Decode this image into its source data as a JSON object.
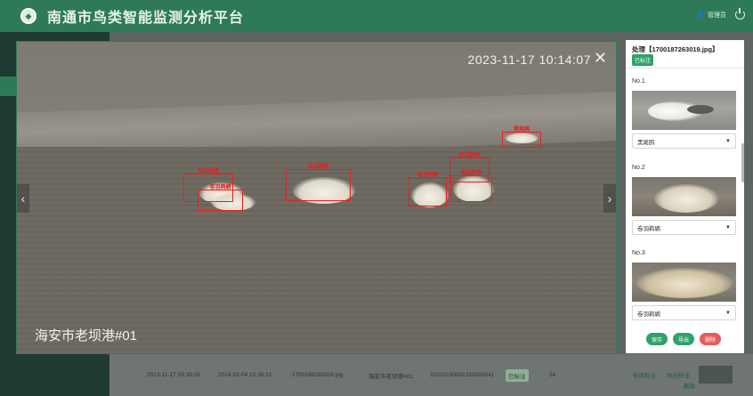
{
  "header": {
    "title": "南通市鸟类智能监测分析平台",
    "user_label": "管理员"
  },
  "background_row": {
    "capture_time": "2023-11-17 09:39:09",
    "process_time": "2024-01-04 10:38:12",
    "filename": "1700185289326.jpg",
    "location": "海安市老坝港#01",
    "device_id": "32010100001320000041",
    "status": "已标注",
    "count": "24",
    "link_edit": "修改标注",
    "link_export": "导出标注",
    "link_delete": "删除"
  },
  "viewer": {
    "timestamp": "2023-11-17 10:14:07",
    "close_icon": "close-icon",
    "camera_label": "海安市老坝港#01",
    "prev_arrow": "‹",
    "next_arrow": "›",
    "close_glyph": "✕",
    "detections": [
      {
        "label": "卷羽鹈鹕"
      },
      {
        "label": "卷羽鹈鹕"
      },
      {
        "label": "卷羽鹈鹕"
      },
      {
        "label": "卷羽鹈鹕"
      },
      {
        "label": "卷羽鹈鹕"
      },
      {
        "label": "卷羽鹈鹕"
      },
      {
        "label": "黑尾鸥"
      }
    ]
  },
  "panel": {
    "title": "处理【1700187263019.jpg】",
    "badge": "已标注",
    "items": [
      {
        "no": "No.1",
        "species": "黑尾鸥"
      },
      {
        "no": "No.2",
        "species": "卷羽鹈鹕"
      },
      {
        "no": "No.3",
        "species": "卷羽鹈鹕"
      }
    ],
    "buttons": {
      "save": "保存",
      "export": "导出",
      "delete": "删除"
    }
  },
  "colors": {
    "header_bg": "#2f7a56",
    "accent_green": "#2fa36a",
    "box_red": "#e32222",
    "delete_red": "#e55b5b"
  }
}
